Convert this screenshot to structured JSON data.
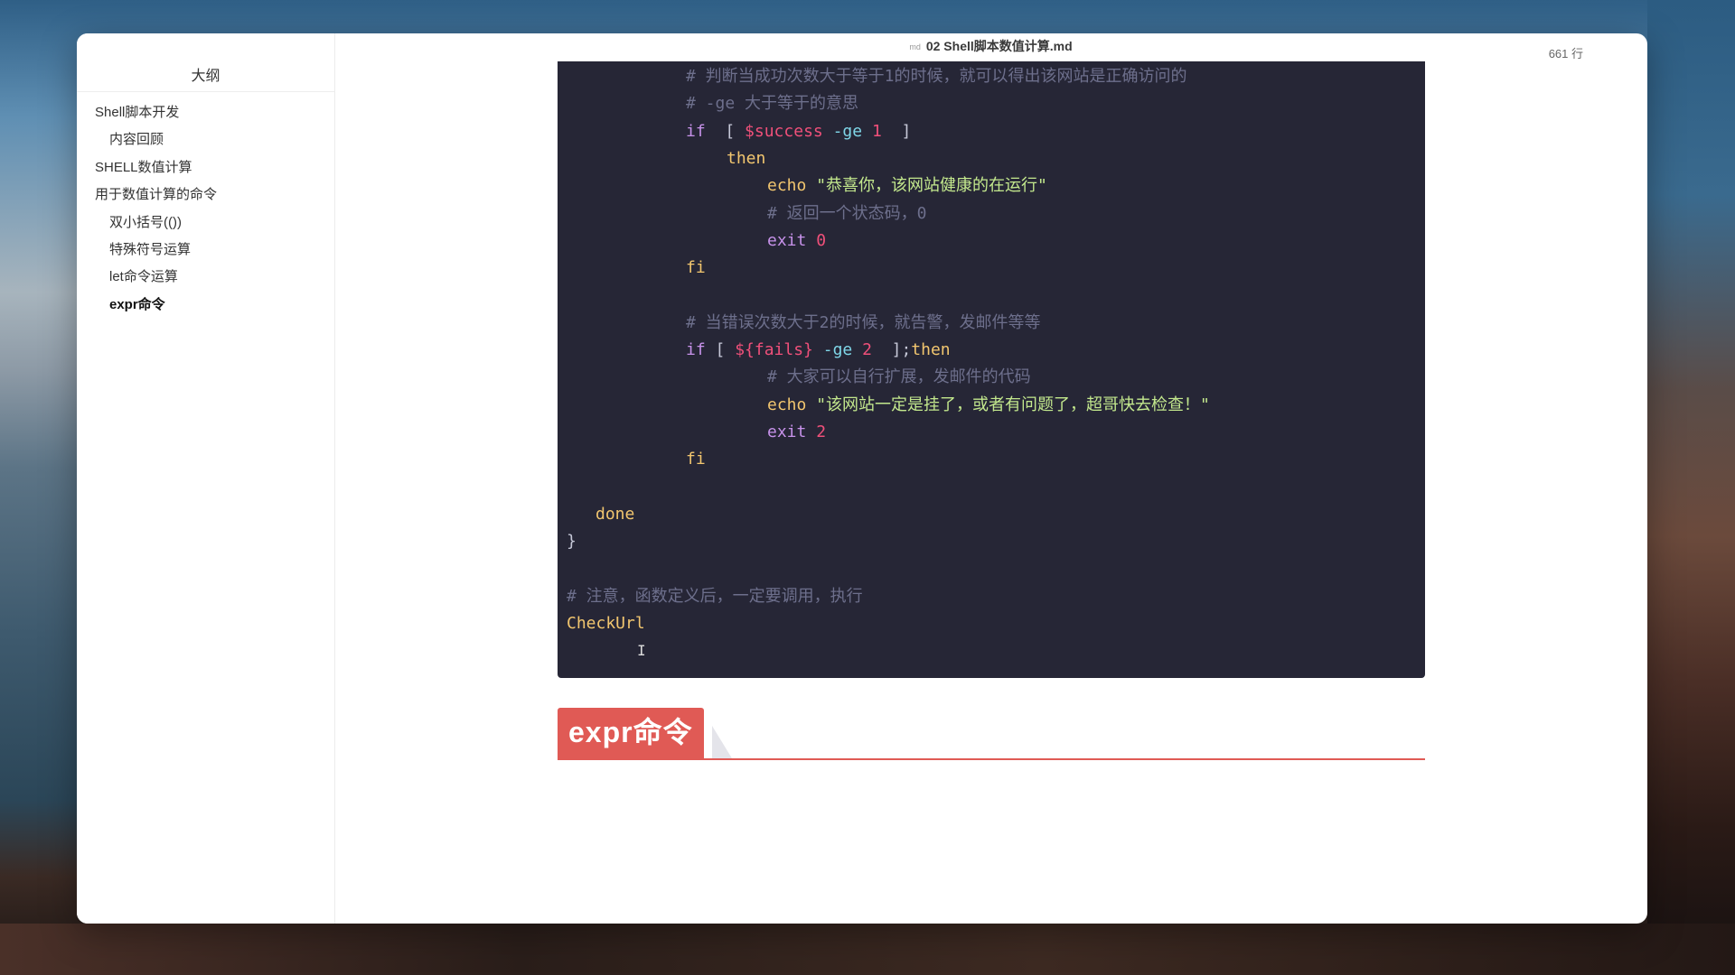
{
  "window": {
    "title": "02 Shell脚本数值计算.md",
    "doc_icon": "md",
    "line_count": "661 行"
  },
  "sidebar": {
    "title": "大纲",
    "items": [
      {
        "label": "Shell脚本开发",
        "level": 1,
        "active": false
      },
      {
        "label": "内容回顾",
        "level": 2,
        "active": false
      },
      {
        "label": "SHELL数值计算",
        "level": 1,
        "active": false
      },
      {
        "label": "用于数值计算的命令",
        "level": 1,
        "active": false
      },
      {
        "label": "双小括号(())",
        "level": 2,
        "active": false
      },
      {
        "label": "特殊符号运算",
        "level": 2,
        "active": false
      },
      {
        "label": "let命令运算",
        "level": 2,
        "active": false
      },
      {
        "label": "expr命令",
        "level": 2,
        "active": true
      }
    ]
  },
  "code": {
    "comment1": "# 判断当成功次数大于等于1的时候，就可以得出该网站是正确访问的",
    "comment2": "# -ge 大于等于的意思",
    "if1_kw": "if",
    "if1_open": "  [ ",
    "if1_var": "$success",
    "if1_op": " -ge ",
    "if1_num": "1",
    "if1_close": "  ]",
    "then1": "then",
    "echo1_cmd": "echo",
    "echo1_str": " \"恭喜你，该网站健康的在运行\"",
    "comment3": "# 返回一个状态码，0",
    "exit1_cmd": "exit",
    "exit1_num": " 0",
    "fi1": "fi",
    "comment4": "# 当错误次数大于2的时候，就告警，发邮件等等",
    "if2_kw": "if",
    "if2_open": " [ ",
    "if2_var": "${fails}",
    "if2_op": " -ge ",
    "if2_num": "2",
    "if2_close": "  ];",
    "then2": "then",
    "comment5": "# 大家可以自行扩展，发邮件的代码",
    "echo2_cmd": "echo",
    "echo2_str": " \"该网站一定是挂了，或者有问题了，超哥快去检查！\"",
    "exit2_cmd": "exit",
    "exit2_num": " 2",
    "fi2": "fi",
    "done": "done",
    "brace": "}",
    "comment6": "# 注意，函数定义后，一定要调用，执行",
    "call": "CheckUrl"
  },
  "heading": {
    "label": "expr命令",
    "accent_color": "#e05a55"
  },
  "cursor": "I"
}
